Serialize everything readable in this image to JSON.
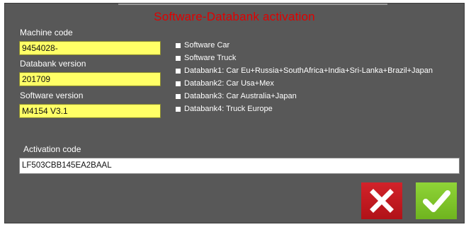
{
  "dialog": {
    "title": "Software-Databank activation"
  },
  "fields": {
    "machine_code": {
      "label": "Machine code",
      "value": "9454028-"
    },
    "databank_version": {
      "label": "Databank version",
      "value": "201709"
    },
    "software_version": {
      "label": "Software version",
      "value": "M4154 V3.1"
    }
  },
  "options": [
    {
      "label": "Software Car",
      "checked": false
    },
    {
      "label": "Software Truck",
      "checked": false
    },
    {
      "label": "Databank1: Car Eu+Russia+SouthAfrica+India+Sri-Lanka+Brazil+Japan",
      "checked": false
    },
    {
      "label": "Databank2: Car Usa+Mex",
      "checked": false
    },
    {
      "label": "Databank3: Car Australia+Japan",
      "checked": false
    },
    {
      "label": "Databank4: Truck Europe",
      "checked": false
    }
  ],
  "activation": {
    "label": "Activation code",
    "value": "LF503CBB145EA2BAAL"
  },
  "buttons": {
    "cancel_icon": "x-icon",
    "confirm_icon": "check-icon"
  },
  "colors": {
    "title": "#e00000",
    "field_bg": "#ffff66",
    "panel_bg": "#585858",
    "cancel": "#c8191f",
    "confirm": "#80c52a"
  }
}
